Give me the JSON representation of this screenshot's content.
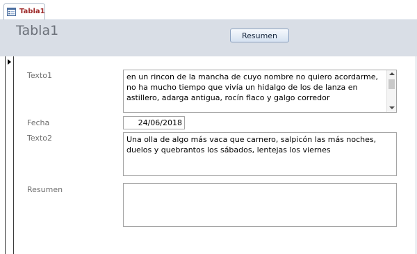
{
  "tab": {
    "label": "Tabla1",
    "icon": "form-icon"
  },
  "header": {
    "title": "Tabla1",
    "resumen_button": "Resumen"
  },
  "fields": {
    "texto1": {
      "label": "Texto1",
      "value": "en un rincon de la mancha de cuyo nombre no quiero acordarme, no ha mucho tiempo que vivía un hidalgo de los de lanza en astillero, adarga antigua, rocín flaco y galgo corredor"
    },
    "fecha": {
      "label": "Fecha",
      "value": "24/06/2018"
    },
    "texto2": {
      "label": "Texto2",
      "value": "Una olla de algo más vaca que carnero, salpicón las más noches, duelos y quebrantos los sábados, lentejas los viernes"
    },
    "resumen": {
      "label": "Resumen",
      "value": ""
    }
  },
  "colors": {
    "header_bg": "#d9dee6",
    "tab_label": "#9e2a2a",
    "label_gray": "#6f6f6f"
  }
}
